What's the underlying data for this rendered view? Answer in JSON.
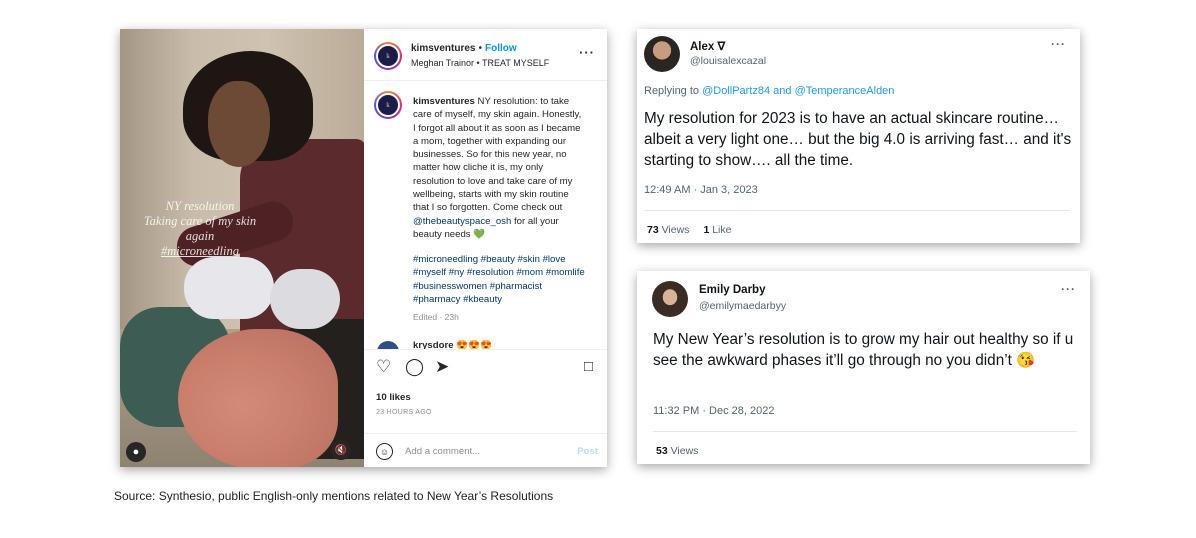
{
  "instagram": {
    "username": "kimsventures",
    "separator": "•",
    "follow_label": "Follow",
    "song": "Meghan Trainor • TREAT MYSELF",
    "avatar_text": "k",
    "photo_overlay": {
      "line1": "NY resolution",
      "line2": "Taking care of my skin",
      "line3": "again",
      "line4": "#microneedling"
    },
    "caption_user": "kimsventures",
    "caption_text": " NY resolution: to take care of myself, my skin again. Honestly, I forgot all about it as soon as I became a mom, together with expanding our businesses. So for this new year, no matter how cliche it is, my only resolution to love and take care of my wellbeing, starts with my skin routine that I so forgotten. Come check out ",
    "caption_mention": "@thebeautyspace_osh",
    "caption_end": " for all your beauty needs ",
    "caption_emoji": "💚",
    "hashtags": "#microneedling #beauty #skin #love #myself #ny #resolution #mom #momlife #businesswomen #pharmacist #pharmacy #kbeauty",
    "edited": "Edited · 23h",
    "next_comment_user": "krysdore",
    "next_comment_emoji": "😍😍😍",
    "likes": "10 likes",
    "time_ago": "23 HOURS AGO",
    "comment_placeholder": "Add a comment...",
    "post_label": "Post",
    "icons": [
      "heart-icon",
      "comment-icon",
      "share-icon",
      "bookmark-icon",
      "emoji-icon",
      "user-icon",
      "mute-icon",
      "more-icon"
    ]
  },
  "tweet1": {
    "name": "Alex ∇",
    "handle": "@louisalexcazal",
    "replying_prefix": "Replying to ",
    "replying_to": "@DollPartz84 and @TemperanceAlden",
    "text": "My resolution for 2023 is to have an actual skincare routine… albeit a very light one… but the big 4.0 is arriving fast… and it's starting to show…. all the time.",
    "timestamp": "12:49 AM · Jan 3, 2023",
    "views_count": "73",
    "views_label": " Views",
    "likes_count": "1",
    "likes_label": " Like",
    "more": "···"
  },
  "tweet2": {
    "name": "Emily Darby",
    "handle": "@emilymaedarbyy",
    "text": "My New Year’s resolution is to grow my hair out healthy so if u see the awkward phases it’ll go through no you didn’t 😘",
    "timestamp": "11:32 PM · Dec 28, 2022",
    "views_count": "53",
    "views_label": " Views",
    "more": "···"
  },
  "source": "Source: Synthesio, public English-only mentions related to New Year’s Resolutions",
  "colors": {
    "link_blue": "#1d9bf0",
    "ig_follow": "#0095f6",
    "ig_tag": "#00376b"
  }
}
